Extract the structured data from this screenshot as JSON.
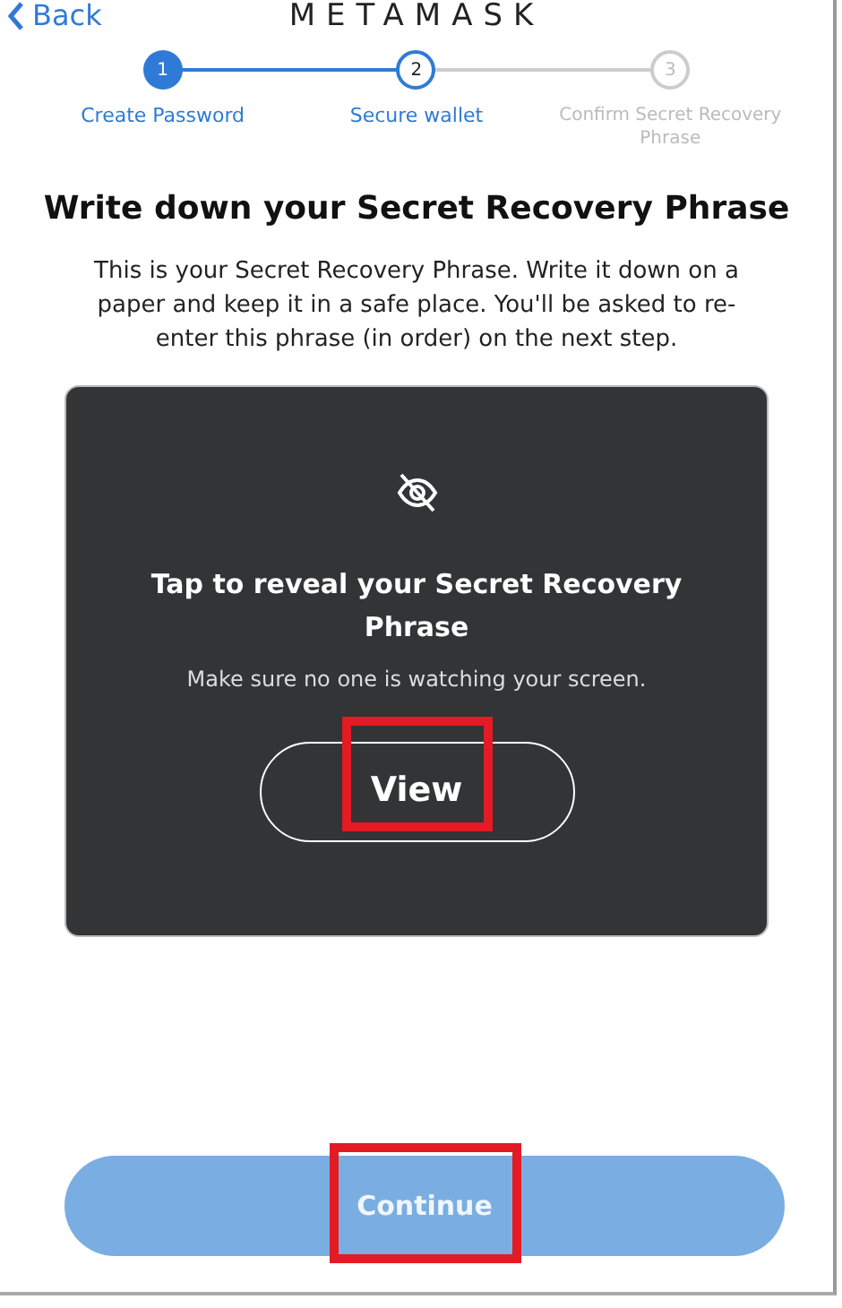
{
  "header": {
    "back": "Back",
    "logo": "METAMASK"
  },
  "steps": [
    {
      "number": "1",
      "label": "Create Password",
      "completed": true,
      "selected": false
    },
    {
      "number": "2",
      "label": "Secure wallet",
      "completed": false,
      "selected": true
    },
    {
      "number": "3",
      "label": "Confirm Secret Recovery Phrase",
      "completed": false,
      "selected": false
    }
  ],
  "title": "Write down your Secret Recovery Phrase",
  "description": "This is your Secret Recovery Phrase. Write it down on a paper and keep it in a safe place. You'll be asked to re-enter this phrase (in order) on the next step.",
  "reveal_card": {
    "title": "Tap to reveal your Secret Recovery Phrase",
    "subtitle": "Make sure no one is watching your screen.",
    "button": {
      "label": "View",
      "highlighted": true
    }
  },
  "continue_button": {
    "label": "Continue",
    "disabled": true,
    "highlighted": true
  }
}
